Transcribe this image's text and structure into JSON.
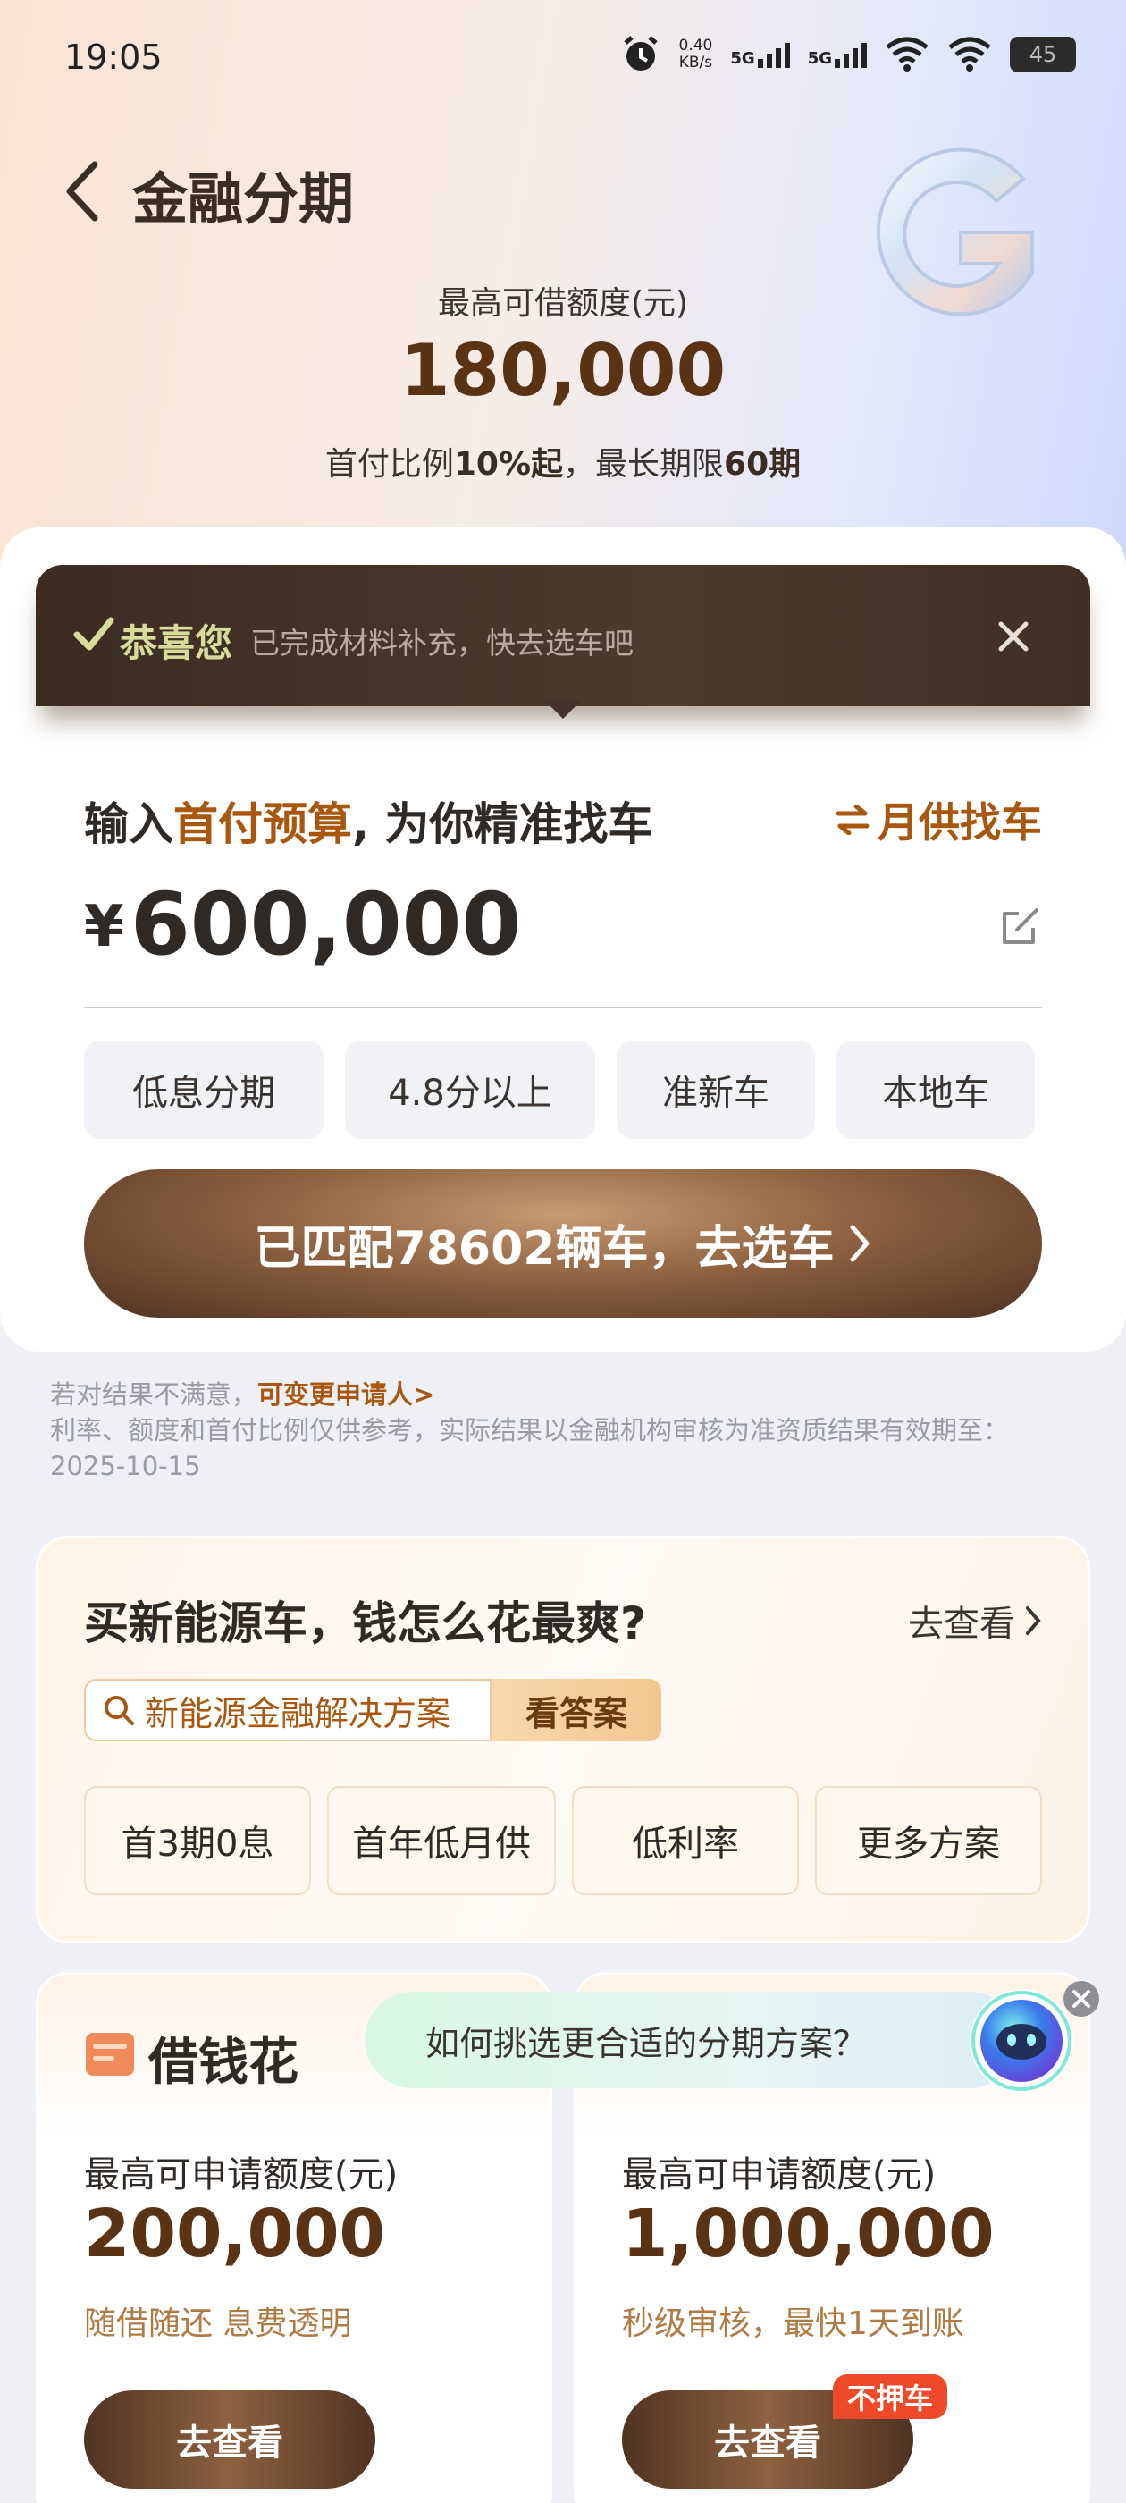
{
  "status_bar": {
    "time": "19:05",
    "net_speed_value": "0.40",
    "net_speed_unit": "KB/s",
    "sim1": "5G",
    "sim2": "5G",
    "battery": "45"
  },
  "header": {
    "title": "金融分期",
    "credit_label": "最高可借额度(元)",
    "credit_amount": "180,000",
    "terms_prefix": "首付比例",
    "terms_ratio": "10%起",
    "terms_mid": "，最长期限",
    "terms_period": "60期"
  },
  "toast": {
    "title": "恭喜您",
    "message": "已完成材料补充，快去选车吧"
  },
  "budget": {
    "heading_prefix": "输入",
    "heading_highlight": "首付预算",
    "heading_suffix": ", 为你精准找车",
    "monthly_link": "月供找车",
    "currency": "¥",
    "value": "600,000",
    "chips": [
      "低息分期",
      "4.8分以上",
      "准新车",
      "本地车"
    ],
    "cta": "已匹配78602辆车，去选车"
  },
  "disclaimer": {
    "prefix": "若对结果不满意，",
    "link": "可变更申请人>",
    "body": "利率、额度和首付比例仅供参考，实际结果以金融机构审核为准资质结果有效期至：2025-10-15"
  },
  "ev_card": {
    "title": "买新能源车，钱怎么花最爽?",
    "more": "去查看",
    "search_text": "新能源金融解决方案",
    "answer_button": "看答案",
    "chips": [
      "首3期0息",
      "首年低月供",
      "低利率",
      "更多方案"
    ]
  },
  "loan_cards": [
    {
      "title": "借钱花",
      "label": "最高可申请额度(元)",
      "amount": "200,000",
      "desc": "随借随还 息费透明",
      "button": "去查看"
    },
    {
      "label": "最高可申请额度(元)",
      "amount": "1,000,000",
      "desc": "秒级审核，最快1天到账",
      "button": "去查看",
      "badge": "不押车"
    }
  ],
  "assistant": {
    "bubble": "如何挑选更合适的分期方案？"
  },
  "colors": {
    "accent": "#a8570f",
    "brown_dark": "#5a3214",
    "badge_red": "#ee4a2a"
  }
}
